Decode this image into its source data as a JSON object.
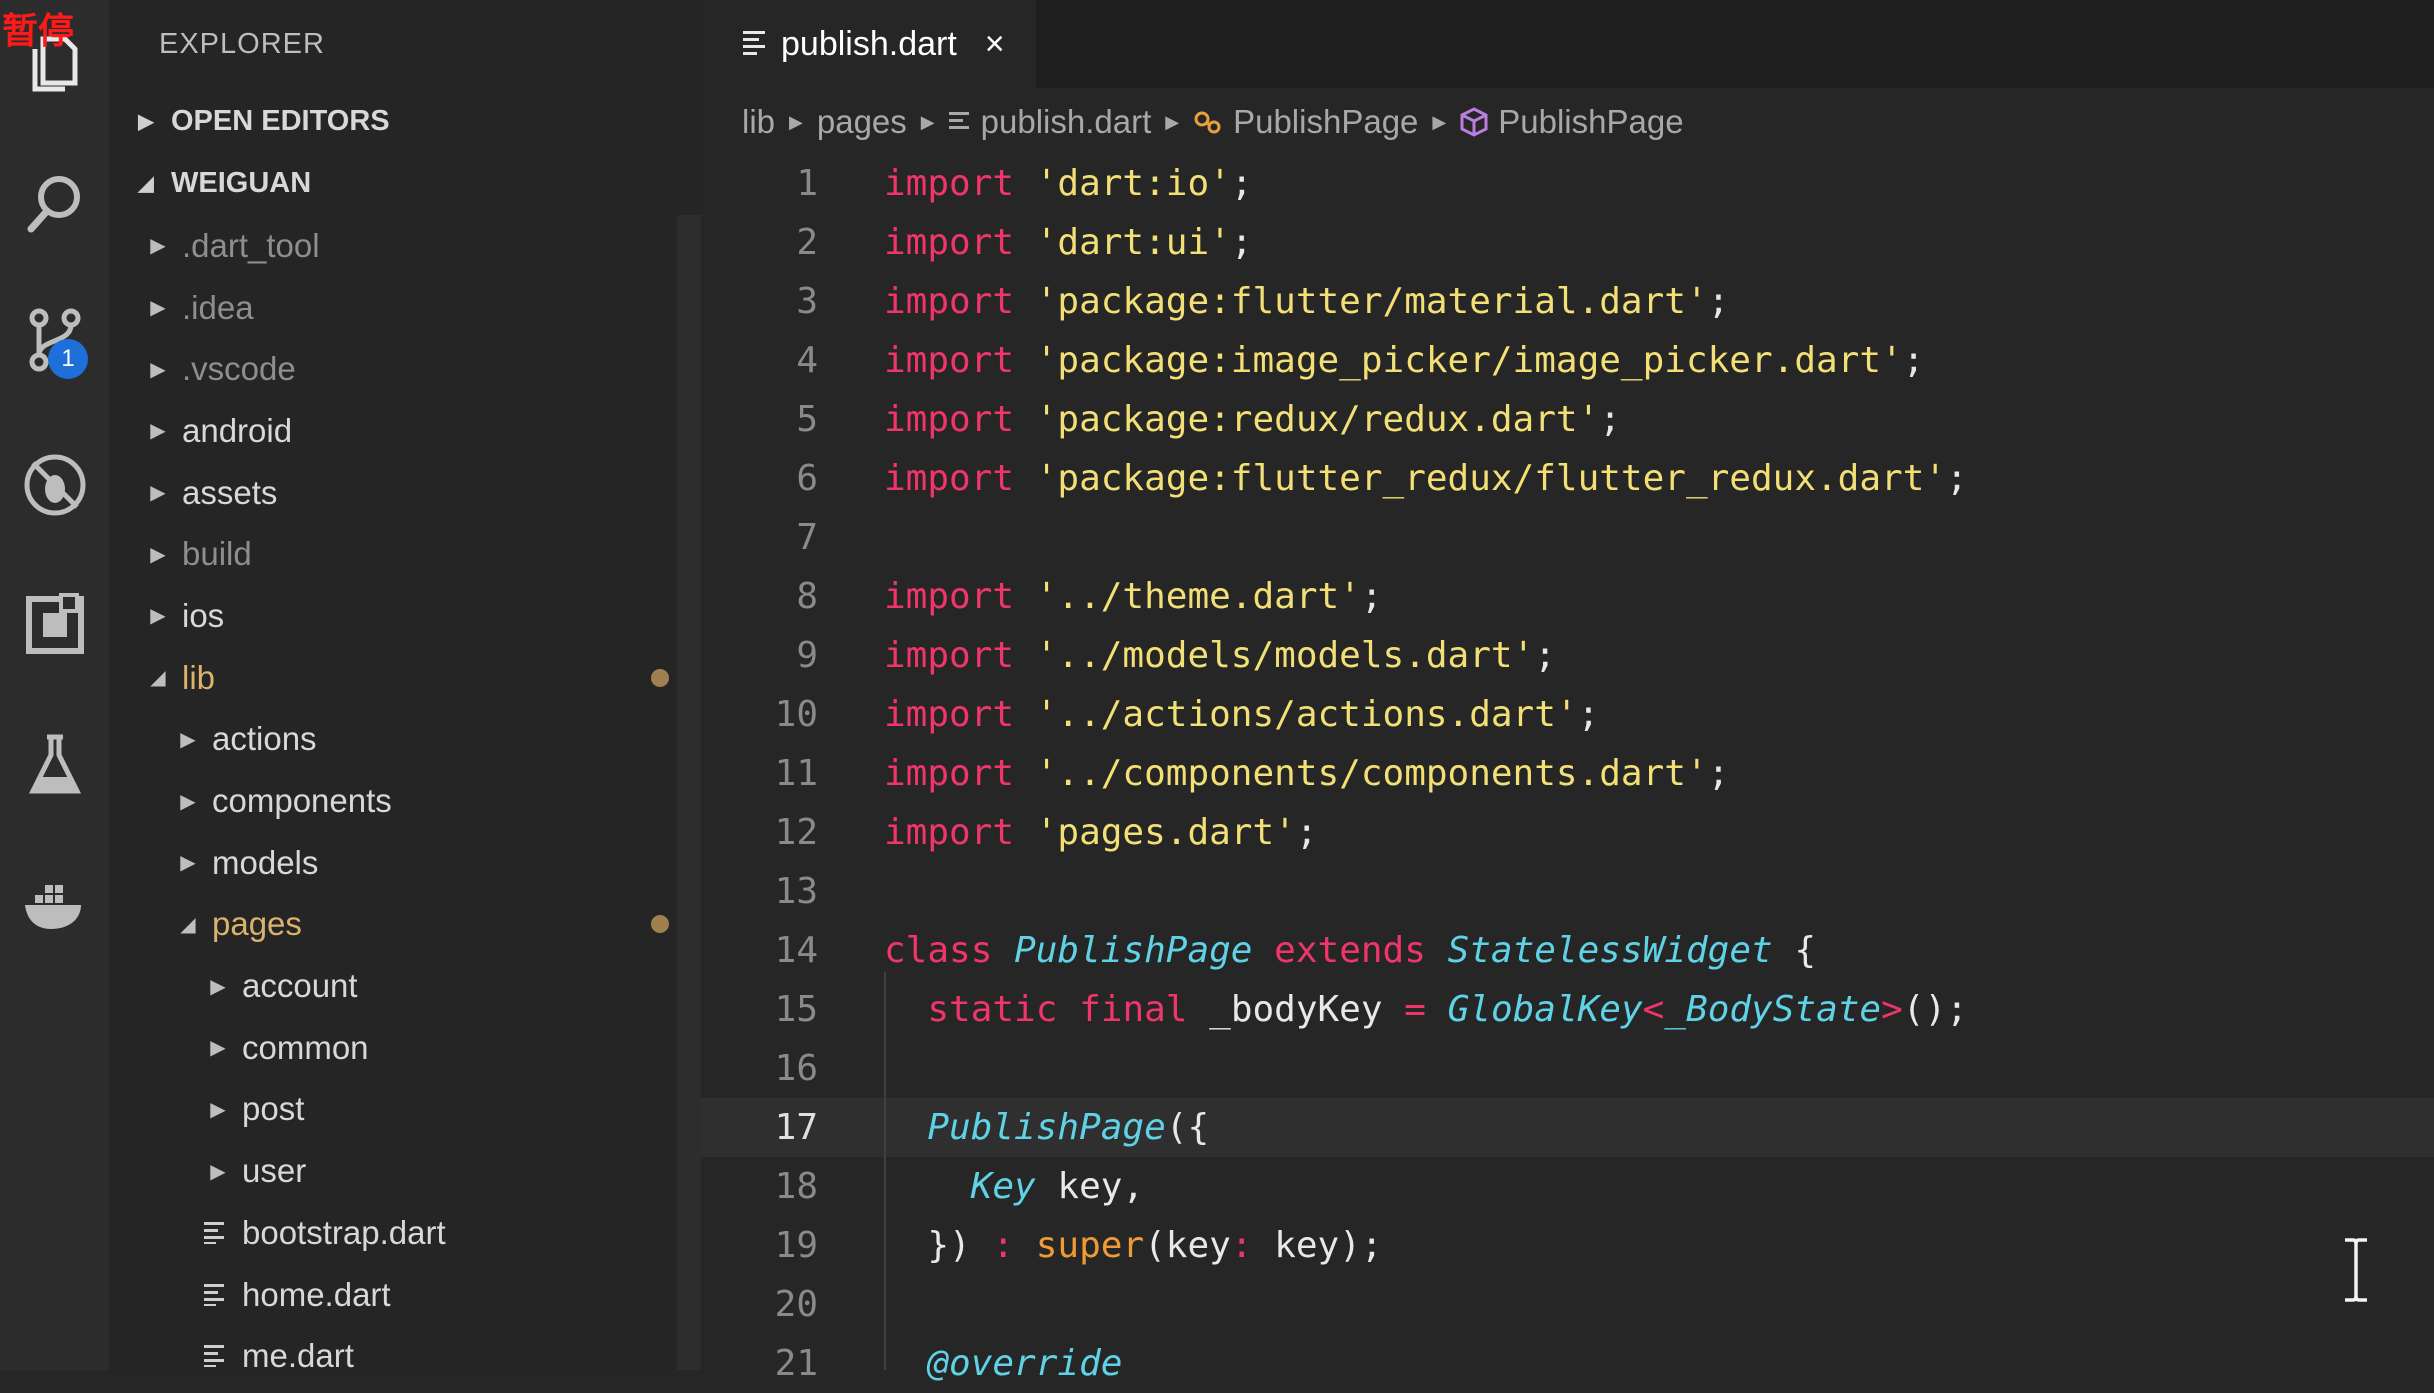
{
  "overlay": {
    "pause_label": "暂停"
  },
  "activity_bar": {
    "items": [
      {
        "name": "explorer-icon"
      },
      {
        "name": "search-icon"
      },
      {
        "name": "source-control-icon",
        "badge": "1"
      },
      {
        "name": "debug-icon"
      },
      {
        "name": "extensions-icon"
      },
      {
        "name": "test-flask-icon"
      },
      {
        "name": "docker-icon"
      }
    ]
  },
  "sidebar": {
    "title": "EXPLORER",
    "sections": [
      {
        "label": "OPEN EDITORS",
        "expanded": false
      },
      {
        "label": "WEIGUAN",
        "expanded": true
      }
    ],
    "tree": [
      {
        "label": ".dart_tool",
        "kind": "folder",
        "expanded": false,
        "depth": 0,
        "dim": true
      },
      {
        "label": ".idea",
        "kind": "folder",
        "expanded": false,
        "depth": 0,
        "dim": true
      },
      {
        "label": ".vscode",
        "kind": "folder",
        "expanded": false,
        "depth": 0,
        "dim": true
      },
      {
        "label": "android",
        "kind": "folder",
        "expanded": false,
        "depth": 0
      },
      {
        "label": "assets",
        "kind": "folder",
        "expanded": false,
        "depth": 0
      },
      {
        "label": "build",
        "kind": "folder",
        "expanded": false,
        "depth": 0,
        "dim": true
      },
      {
        "label": "ios",
        "kind": "folder",
        "expanded": false,
        "depth": 0
      },
      {
        "label": "lib",
        "kind": "folder",
        "expanded": true,
        "depth": 0,
        "modified": true
      },
      {
        "label": "actions",
        "kind": "folder",
        "expanded": false,
        "depth": 1
      },
      {
        "label": "components",
        "kind": "folder",
        "expanded": false,
        "depth": 1
      },
      {
        "label": "models",
        "kind": "folder",
        "expanded": false,
        "depth": 1
      },
      {
        "label": "pages",
        "kind": "folder",
        "expanded": true,
        "depth": 1,
        "modified": true
      },
      {
        "label": "account",
        "kind": "folder",
        "expanded": false,
        "depth": 2
      },
      {
        "label": "common",
        "kind": "folder",
        "expanded": false,
        "depth": 2
      },
      {
        "label": "post",
        "kind": "folder",
        "expanded": false,
        "depth": 2
      },
      {
        "label": "user",
        "kind": "folder",
        "expanded": false,
        "depth": 2
      },
      {
        "label": "bootstrap.dart",
        "kind": "file",
        "depth": 2
      },
      {
        "label": "home.dart",
        "kind": "file",
        "depth": 2
      },
      {
        "label": "me.dart",
        "kind": "file",
        "depth": 2
      }
    ]
  },
  "editor": {
    "tab": {
      "label": "publish.dart",
      "close": "×"
    },
    "breadcrumbs": [
      "lib",
      "pages",
      "publish.dart",
      "PublishPage",
      "PublishPage"
    ],
    "current_line": 17,
    "lines": [
      {
        "n": "1",
        "tokens": [
          [
            "k",
            "import"
          ],
          [
            "p",
            " "
          ],
          [
            "s",
            "'dart:io'"
          ],
          [
            "p",
            ";"
          ]
        ]
      },
      {
        "n": "2",
        "tokens": [
          [
            "k",
            "import"
          ],
          [
            "p",
            " "
          ],
          [
            "s",
            "'dart:ui'"
          ],
          [
            "p",
            ";"
          ]
        ]
      },
      {
        "n": "3",
        "tokens": [
          [
            "k",
            "import"
          ],
          [
            "p",
            " "
          ],
          [
            "s",
            "'package:flutter/material.dart'"
          ],
          [
            "p",
            ";"
          ]
        ]
      },
      {
        "n": "4",
        "tokens": [
          [
            "k",
            "import"
          ],
          [
            "p",
            " "
          ],
          [
            "s",
            "'package:image_picker/image_picker.dart'"
          ],
          [
            "p",
            ";"
          ]
        ]
      },
      {
        "n": "5",
        "tokens": [
          [
            "k",
            "import"
          ],
          [
            "p",
            " "
          ],
          [
            "s",
            "'package:redux/redux.dart'"
          ],
          [
            "p",
            ";"
          ]
        ]
      },
      {
        "n": "6",
        "tokens": [
          [
            "k",
            "import"
          ],
          [
            "p",
            " "
          ],
          [
            "s",
            "'package:flutter_redux/flutter_redux.dart'"
          ],
          [
            "p",
            ";"
          ]
        ]
      },
      {
        "n": "7",
        "tokens": []
      },
      {
        "n": "8",
        "tokens": [
          [
            "k",
            "import"
          ],
          [
            "p",
            " "
          ],
          [
            "s",
            "'../theme.dart'"
          ],
          [
            "p",
            ";"
          ]
        ]
      },
      {
        "n": "9",
        "tokens": [
          [
            "k",
            "import"
          ],
          [
            "p",
            " "
          ],
          [
            "s",
            "'../models/models.dart'"
          ],
          [
            "p",
            ";"
          ]
        ]
      },
      {
        "n": "10",
        "tokens": [
          [
            "k",
            "import"
          ],
          [
            "p",
            " "
          ],
          [
            "s",
            "'../actions/actions.dart'"
          ],
          [
            "p",
            ";"
          ]
        ]
      },
      {
        "n": "11",
        "tokens": [
          [
            "k",
            "import"
          ],
          [
            "p",
            " "
          ],
          [
            "s",
            "'../components/components.dart'"
          ],
          [
            "p",
            ";"
          ]
        ]
      },
      {
        "n": "12",
        "tokens": [
          [
            "k",
            "import"
          ],
          [
            "p",
            " "
          ],
          [
            "s",
            "'pages.dart'"
          ],
          [
            "p",
            ";"
          ]
        ]
      },
      {
        "n": "13",
        "tokens": []
      },
      {
        "n": "14",
        "tokens": [
          [
            "k",
            "class"
          ],
          [
            "p",
            " "
          ],
          [
            "t",
            "PublishPage"
          ],
          [
            "p",
            " "
          ],
          [
            "k",
            "extends"
          ],
          [
            "p",
            " "
          ],
          [
            "t",
            "StatelessWidget"
          ],
          [
            "p",
            " {"
          ]
        ]
      },
      {
        "n": "15",
        "tokens": [
          [
            "p",
            "  "
          ],
          [
            "k",
            "static"
          ],
          [
            "p",
            " "
          ],
          [
            "k",
            "final"
          ],
          [
            "p",
            " _bodyKey "
          ],
          [
            "o",
            "="
          ],
          [
            "p",
            " "
          ],
          [
            "t",
            "GlobalKey"
          ],
          [
            "o",
            "<"
          ],
          [
            "t",
            "_BodyState"
          ],
          [
            "o",
            ">"
          ],
          [
            "p",
            "();"
          ]
        ]
      },
      {
        "n": "16",
        "tokens": []
      },
      {
        "n": "17",
        "tokens": [
          [
            "p",
            "  "
          ],
          [
            "t",
            "PublishPage"
          ],
          [
            "p",
            "({"
          ]
        ]
      },
      {
        "n": "18",
        "tokens": [
          [
            "p",
            "    "
          ],
          [
            "t",
            "Key"
          ],
          [
            "p",
            " key,"
          ]
        ]
      },
      {
        "n": "19",
        "tokens": [
          [
            "p",
            "  }) "
          ],
          [
            "o",
            ":"
          ],
          [
            "p",
            " "
          ],
          [
            "f",
            "super"
          ],
          [
            "p",
            "(key"
          ],
          [
            "o",
            ":"
          ],
          [
            "p",
            " key);"
          ]
        ]
      },
      {
        "n": "20",
        "tokens": []
      },
      {
        "n": "21",
        "tokens": [
          [
            "p",
            "  "
          ],
          [
            "a",
            "@override"
          ]
        ]
      }
    ]
  }
}
